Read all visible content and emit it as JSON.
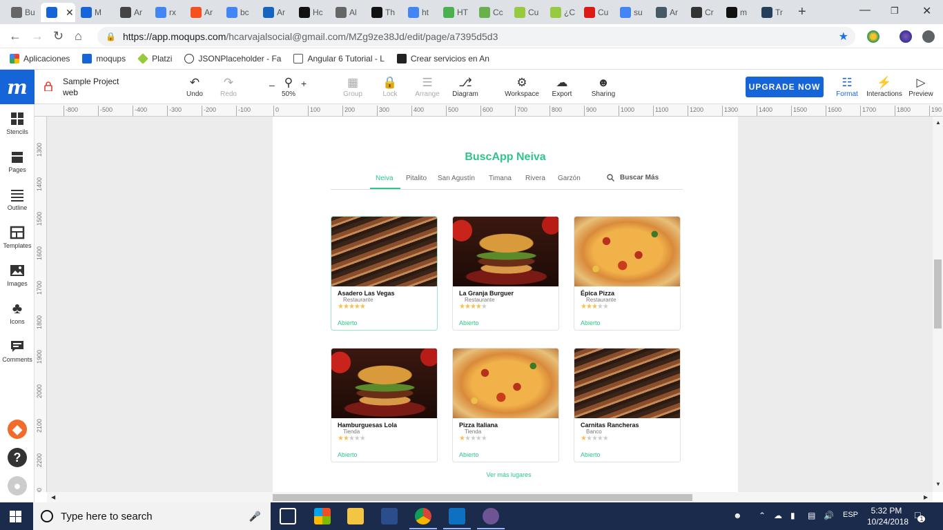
{
  "browser": {
    "tabs": [
      {
        "label": "Bu",
        "icon": "doc-icon",
        "color": "#666666"
      },
      {
        "label": "",
        "icon": "moqups-icon",
        "color": "#1565d8",
        "active": true
      },
      {
        "label": "M",
        "icon": "moqups-icon",
        "color": "#1565d8"
      },
      {
        "label": "Ar",
        "icon": "download-icon",
        "color": "#444444"
      },
      {
        "label": "rx",
        "icon": "google-icon",
        "color": "#4285f4"
      },
      {
        "label": "Ar",
        "icon": "app-icon",
        "color": "#f4511e"
      },
      {
        "label": "bc",
        "icon": "google-icon",
        "color": "#4285f4"
      },
      {
        "label": "Ar",
        "icon": "bootstrap-icon",
        "color": "#1565c0"
      },
      {
        "label": "Hc",
        "icon": "medium-icon",
        "color": "#111111"
      },
      {
        "label": "Al",
        "icon": "doc-icon",
        "color": "#666666"
      },
      {
        "label": "Th",
        "icon": "medium-icon",
        "color": "#111111"
      },
      {
        "label": "ht",
        "icon": "google-icon",
        "color": "#4285f4"
      },
      {
        "label": "HT",
        "icon": "w3-icon",
        "color": "#4caf50"
      },
      {
        "label": "Cc",
        "icon": "leaf-icon",
        "color": "#6ab04c"
      },
      {
        "label": "Cu",
        "icon": "platzi-icon",
        "color": "#98ca3f"
      },
      {
        "label": "¿C",
        "icon": "platzi-icon",
        "color": "#98ca3f"
      },
      {
        "label": "Cu",
        "icon": "angular-icon",
        "color": "#dd1b16"
      },
      {
        "label": "su",
        "icon": "google-icon",
        "color": "#4285f4"
      },
      {
        "label": "Ar",
        "icon": "grid-icon",
        "color": "#455a64"
      },
      {
        "label": "Cr",
        "icon": "app-icon",
        "color": "#333333"
      },
      {
        "label": "m",
        "icon": "github-icon",
        "color": "#111111"
      },
      {
        "label": "Tr",
        "icon": "hex-icon",
        "color": "#24405c"
      }
    ],
    "url_host": "https://app.moqups.com",
    "url_path": "/hcarvajalsocial@gmail.com/MZg9ze38Jd/edit/page/a7395d5d3",
    "bookmarks": [
      "Aplicaciones",
      "moqups",
      "Platzi",
      "JSONPlaceholder - Fa",
      "Angular 6 Tutorial - L",
      "Crear servicios en An"
    ]
  },
  "moqups": {
    "project_name": "Sample Project",
    "page_name": "web",
    "tools": {
      "undo": "Undo",
      "redo": "Redo",
      "zoom": "50%",
      "group": "Group",
      "lock": "Lock",
      "arrange": "Arrange",
      "diagram": "Diagram",
      "workspace": "Workspace",
      "export": "Export",
      "sharing": "Sharing",
      "upgrade": "UPGRADE NOW",
      "format": "Format",
      "interactions": "Interactions",
      "preview": "Preview"
    },
    "sidebar": [
      "Stencils",
      "Pages",
      "Outline",
      "Templates",
      "Images",
      "Icons",
      "Comments"
    ],
    "ruler_top": [
      "-800",
      "-500",
      "-400",
      "-300",
      "-200",
      "-100",
      "0",
      "100",
      "200",
      "300",
      "400",
      "500",
      "600",
      "700",
      "800",
      "900",
      "1000",
      "1100",
      "1200",
      "1300",
      "1400",
      "1500",
      "1600",
      "1700",
      "1800",
      "190"
    ],
    "ruler_left": [
      "1300",
      "1400",
      "1500",
      "1600",
      "1700",
      "1800",
      "1900",
      "2000",
      "2100",
      "2200",
      "2300"
    ]
  },
  "mockup": {
    "title": "BuscApp Neiva",
    "nav": [
      "Neiva",
      "Pitalito",
      "San Agustín",
      "Timana",
      "Rivera",
      "Garzón"
    ],
    "search": "Buscar Más",
    "cards": [
      {
        "name": "Asadero Las Vegas",
        "category": "Restaurante",
        "rating": 5,
        "status": "Abierto",
        "image": "grill"
      },
      {
        "name": "La Granja Burguer",
        "category": "Restaurante",
        "rating": 4,
        "status": "Abierto",
        "image": "burger"
      },
      {
        "name": "Épica Pizza",
        "category": "Restaurante",
        "rating": 3,
        "status": "Abierto",
        "image": "pizza"
      },
      {
        "name": "Hamburguesas Lola",
        "category": "Tienda",
        "rating": 2,
        "status": "Abierto",
        "image": "burger"
      },
      {
        "name": "Pizza Italiana",
        "category": "Tienda",
        "rating": 1,
        "status": "Abierto",
        "image": "pizza"
      },
      {
        "name": "Carnitas Rancheras",
        "category": "Banco",
        "rating": 1,
        "status": "Abierto",
        "image": "grill"
      }
    ],
    "more": "Ver más lugares",
    "accent": "#2ec58a"
  },
  "taskbar": {
    "search_placeholder": "Type here to search",
    "language": "ESP",
    "time": "5:32 PM",
    "date": "10/24/2018",
    "notifications": "1"
  }
}
